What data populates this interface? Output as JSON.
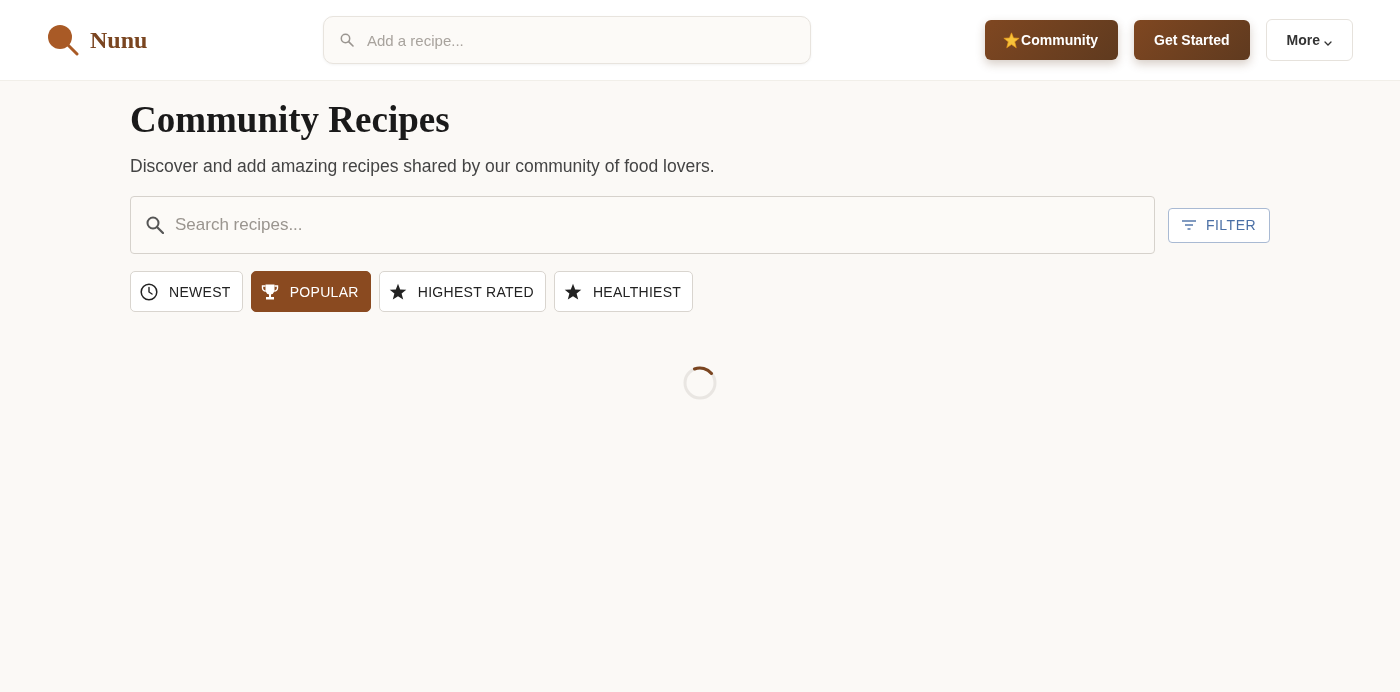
{
  "header": {
    "logo": {
      "name": "Nunu"
    },
    "search": {
      "placeholder": "Add a recipe..."
    },
    "nav_buttons": [
      {
        "label": "Community",
        "kind": "featured"
      },
      {
        "label": "Get Started",
        "kind": "primary"
      },
      {
        "label": "More",
        "kind": "menu"
      }
    ]
  },
  "page": {
    "title": "Community Recipes",
    "subtitle": "Discover and add amazing recipes shared by our community of food lovers."
  },
  "search": {
    "placeholder": "Search recipes..."
  },
  "filter_button": {
    "label": "FILTER"
  },
  "sort_options": [
    {
      "label": "NEWEST",
      "selected": false
    },
    {
      "label": "POPULAR",
      "selected": true
    },
    {
      "label": "HIGHEST RATED",
      "selected": false
    },
    {
      "label": "HEALTHIEST",
      "selected": false
    }
  ],
  "loading": true
}
